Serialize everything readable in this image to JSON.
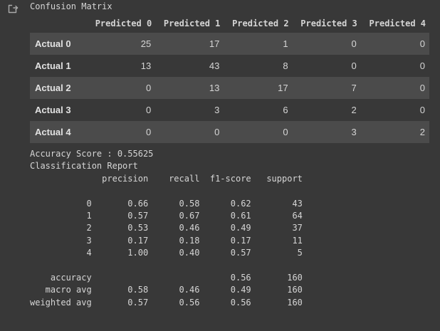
{
  "confusion_matrix": {
    "title": "Confusion Matrix",
    "columns": [
      "Predicted 0",
      "Predicted 1",
      "Predicted 2",
      "Predicted 3",
      "Predicted 4"
    ],
    "rows": [
      {
        "label": "Actual 0",
        "values": [
          "25",
          "17",
          "1",
          "0",
          "0"
        ]
      },
      {
        "label": "Actual 1",
        "values": [
          "13",
          "43",
          "8",
          "0",
          "0"
        ]
      },
      {
        "label": "Actual 2",
        "values": [
          "0",
          "13",
          "17",
          "7",
          "0"
        ]
      },
      {
        "label": "Actual 3",
        "values": [
          "0",
          "3",
          "6",
          "2",
          "0"
        ]
      },
      {
        "label": "Actual 4",
        "values": [
          "0",
          "0",
          "0",
          "3",
          "2"
        ]
      }
    ]
  },
  "report_text": [
    "Accuracy Score : 0.55625",
    "Classification Report",
    "              precision    recall  f1-score   support",
    "",
    "           0       0.66      0.58      0.62        43",
    "           1       0.57      0.67      0.61        64",
    "           2       0.53      0.46      0.49        37",
    "           3       0.17      0.18      0.17        11",
    "           4       1.00      0.40      0.57         5",
    "",
    "    accuracy                           0.56       160",
    "   macro avg       0.58      0.46      0.49       160",
    "weighted avg       0.57      0.56      0.56       160"
  ],
  "icons": {
    "output": "output-redirect-icon"
  }
}
